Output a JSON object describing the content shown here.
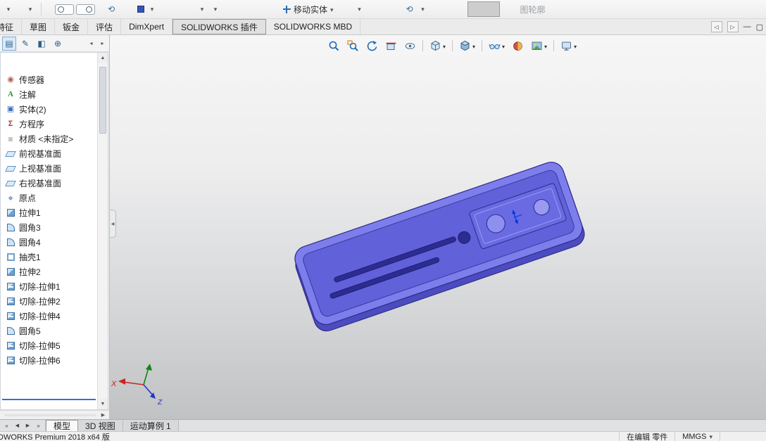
{
  "top_toolbar": {
    "move_entity_label": "移动实体",
    "contour_label": "图轮廓",
    "icons": [
      "dropdown",
      "dropdown",
      "selection-toggle-left",
      "selection-toggle-right",
      "reorient",
      "color-swatch",
      "dropdown",
      "dropdown",
      "dropdown",
      "move-entity",
      "dropdown",
      "dropdown",
      "pressed-blank"
    ]
  },
  "ribbon": {
    "tabs": [
      "特征",
      "草图",
      "钣金",
      "评估",
      "DimXpert",
      "SOLIDWORKS 插件",
      "SOLIDWORKS MBD"
    ],
    "active_tab": "SOLIDWORKS 插件"
  },
  "panel_toolbar": {
    "icons": [
      "featuremanager-design-tree",
      "propertymanager",
      "configuration-manager",
      "dimxpert-manager",
      "scroll-left",
      "scroll-right"
    ]
  },
  "feature_tree": {
    "items": [
      {
        "label": "传感器",
        "icon": "sensor-icon"
      },
      {
        "label": "注解",
        "icon": "annotations-icon"
      },
      {
        "label": "实体(2)",
        "icon": "solid-bodies-icon"
      },
      {
        "label": "方程序",
        "icon": "equations-icon"
      },
      {
        "label": "材质 <未指定>",
        "icon": "material-icon"
      },
      {
        "label": "前视基准面",
        "icon": "plane-icon"
      },
      {
        "label": "上视基准面",
        "icon": "plane-icon"
      },
      {
        "label": "右视基准面",
        "icon": "plane-icon"
      },
      {
        "label": "原点",
        "icon": "origin-icon"
      },
      {
        "label": "拉伸1",
        "icon": "extrude-icon"
      },
      {
        "label": "圆角3",
        "icon": "fillet-icon"
      },
      {
        "label": "圆角4",
        "icon": "fillet-icon"
      },
      {
        "label": "抽壳1",
        "icon": "shell-icon"
      },
      {
        "label": "拉伸2",
        "icon": "extrude-icon"
      },
      {
        "label": "切除-拉伸1",
        "icon": "cut-extrude-icon"
      },
      {
        "label": "切除-拉伸2",
        "icon": "cut-extrude-icon"
      },
      {
        "label": "切除-拉伸4",
        "icon": "cut-extrude-icon"
      },
      {
        "label": "圆角5",
        "icon": "fillet-icon"
      },
      {
        "label": "切除-拉伸5",
        "icon": "cut-extrude-icon"
      },
      {
        "label": "切除-拉伸6",
        "icon": "cut-extrude-icon"
      }
    ]
  },
  "heads_up_toolbar": {
    "icons": [
      "zoom-to-fit",
      "zoom-to-area",
      "previous-view",
      "section-view",
      "annotation-views",
      "view-orientation",
      "display-style",
      "hide-show-items",
      "edit-appearance",
      "apply-scene",
      "view-settings"
    ]
  },
  "viewport": {
    "triad": {
      "x_label": "X",
      "z_label": "Z"
    }
  },
  "bottom_tabs": {
    "items": [
      "模型",
      "3D 视图",
      "运动算例 1"
    ],
    "active": "模型",
    "nav_icons": [
      "first",
      "previous",
      "next",
      "last"
    ]
  },
  "status_bar": {
    "app_version": "DWORKS Premium 2018 x64 版",
    "editing_status": "在编辑 零件",
    "units": "MMGS"
  },
  "colors": {
    "part_blue": "#6a6ae0",
    "rollback_blue": "#2f6fe0"
  }
}
